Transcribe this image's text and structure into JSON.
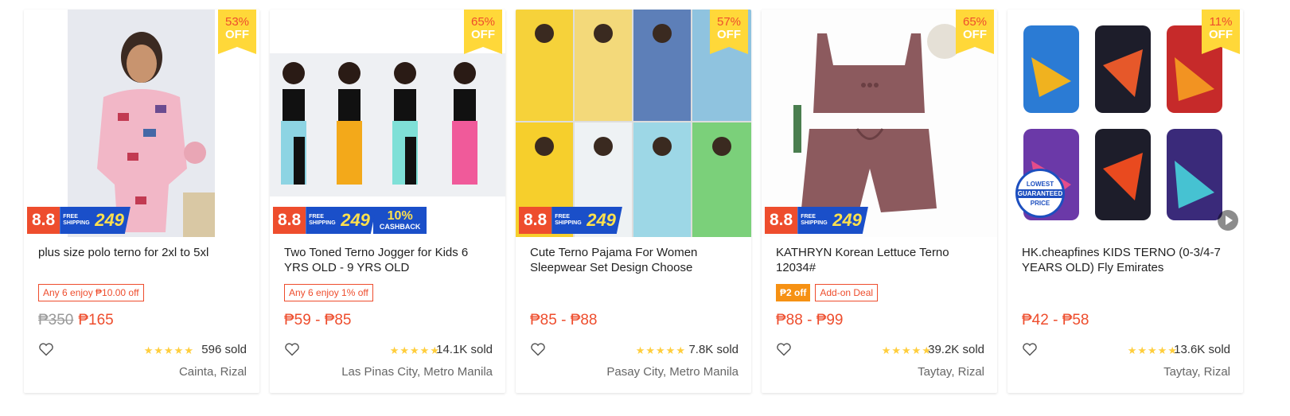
{
  "products": [
    {
      "title": "plus size polo terno for 2xl to 5xl",
      "discount": "53%",
      "off": "OFF",
      "promo_88": "8.8",
      "promo_fs_text": "FREE SHIPPING",
      "promo_fs_amount": "249",
      "tags": [
        {
          "text": "Any 6 enjoy ₱10.00 off",
          "style": "outline"
        }
      ],
      "original_price": "₱350",
      "price": "₱165",
      "stars": "★★★★★",
      "sold": "596 sold",
      "location": "Cainta, Rizal"
    },
    {
      "title": "Two Toned Terno Jogger for Kids 6 YRS OLD - 9 YRS OLD",
      "discount": "65%",
      "off": "OFF",
      "promo_88": "8.8",
      "promo_fs_text": "FREE SHIPPING",
      "promo_fs_amount": "249",
      "promo_cashback_pct": "10%",
      "promo_cashback_text": "CASHBACK",
      "tags": [
        {
          "text": "Any 6 enjoy 1% off",
          "style": "outline"
        }
      ],
      "original_price": "",
      "price": "₱59 - ₱85",
      "stars": "★★★★★",
      "sold": "14.1K sold",
      "location": "Las Pinas City, Metro Manila"
    },
    {
      "title": "Cute Terno Pajama For Women Sleepwear Set Design Choose",
      "discount": "57%",
      "off": "OFF",
      "promo_88": "8.8",
      "promo_fs_text": "FREE SHIPPING",
      "promo_fs_amount": "249",
      "tags": [],
      "original_price": "",
      "price": "₱85 - ₱88",
      "stars": "★★★★★",
      "sold": "7.8K sold",
      "location": "Pasay City, Metro Manila"
    },
    {
      "title": "KATHRYN Korean Lettuce Terno 12034#",
      "discount": "65%",
      "off": "OFF",
      "promo_88": "8.8",
      "promo_fs_text": "FREE SHIPPING",
      "promo_fs_amount": "249",
      "tags": [
        {
          "text": "₱2 off",
          "style": "solid"
        },
        {
          "text": "Add-on Deal",
          "style": "outline"
        }
      ],
      "original_price": "",
      "price": "₱88 - ₱99",
      "stars": "★★★★★",
      "sold": "39.2K sold",
      "location": "Taytay, Rizal"
    },
    {
      "title": "HK.cheapfines KIDS TERNO (0-3/4-7 YEARS OLD) Fly Emirates",
      "discount": "11%",
      "off": "OFF",
      "badge_top": "LOWEST",
      "badge_mid": "GUARANTEED",
      "badge_bot": "PRICE",
      "tags": [],
      "original_price": "",
      "price": "₱42 - ₱58",
      "stars": "★★★★★",
      "sold": "13.6K sold",
      "location": "Taytay, Rizal"
    }
  ],
  "colors": {
    "accent": "#ee4d2d",
    "discount_bg": "#ffd839",
    "star": "#ffce3d",
    "promo_blue": "#1a4fc9",
    "solid_tag": "#f69113"
  },
  "icons": {
    "favorite": "heart-outline-icon",
    "video": "play-icon"
  }
}
